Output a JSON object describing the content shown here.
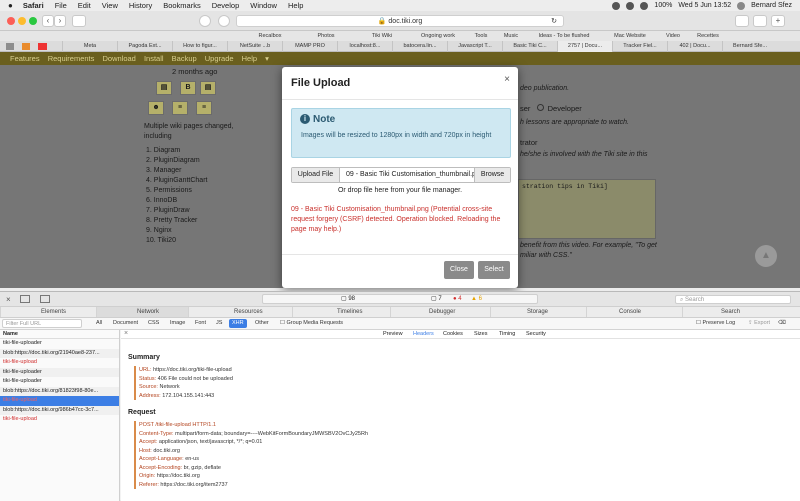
{
  "menubar": {
    "apple": "",
    "app": "Safari",
    "items": [
      "File",
      "Edit",
      "View",
      "History",
      "Bookmarks",
      "Develop",
      "Window",
      "Help"
    ],
    "battery": "100%",
    "clock": "Wed 5 Jun  13:52",
    "user": "Bernard Sfez"
  },
  "toolbar": {
    "url": "doc.tiki.org",
    "back": "‹",
    "forward": "›",
    "reload": "↻"
  },
  "favorites": [
    "Recalbox",
    "Photos",
    "Tiki Wiki",
    "Ongoing work",
    "Tools",
    "Music",
    "Ideas - To be flushed",
    "Mac Website",
    "Video",
    "Recettes"
  ],
  "tabs": [
    "Meta",
    "Pagoda Ext...",
    "How to figur...",
    "NetSuite ...b",
    "MAMP PRO",
    "localhost:8...",
    "batocera.lin...",
    "Javascript T...",
    "Basic Tiki C...",
    "2757 | Docu...",
    "Tracker Fiel...",
    "402 | Docu...",
    "Bernard Sfe..."
  ],
  "site": {
    "nav": [
      "Features",
      "Requirements",
      "Download",
      "Install",
      "Backup",
      "Upgrade",
      "Help"
    ],
    "nav_caret": "▾",
    "time_ago": "2 months ago",
    "summary_line1": "Multiple wiki pages changed,",
    "summary_line2": "including",
    "pages": [
      "1.  Diagram",
      "2.  PluginDiagram",
      "3.  Manager",
      "4.  PluginGanttChart",
      "5.  Permissions",
      "6.  InnoDB",
      "7.  PluginDraw",
      "8.  Pretty Tracker",
      "9.  Nginx",
      "10. Tiki20"
    ],
    "right_text1": "deo publication.",
    "right_radio1": "ser",
    "right_radio2": "Developer",
    "right_text2": "h lessons are appropriate to watch.",
    "right_text3": "trator",
    "right_text4": "he/she is involved with the Tiki site in this",
    "right_text5": "stration tips in Tiki]",
    "right_text6": "benefit from this video. For example, \"To get",
    "right_text7": "miliar with CSS.\""
  },
  "modal": {
    "title": "File Upload",
    "close": "×",
    "note_title": "Note",
    "note_icon": "i",
    "note_text": "Images will be resized to 1280px in width and 720px in height",
    "upload_label": "Upload File",
    "file_name": "09 - Basic Tiki Customisation_thumbnail.png",
    "browse": "Browse",
    "drop_text": "Or drop file here from your file manager.",
    "error": "09 - Basic Tiki Customisation_thumbnail.png (Potential cross-site request forgery (CSRF) detected. Operation blocked. Reloading the page may help.)",
    "close_button": "Close",
    "select_button": "Select"
  },
  "devtools": {
    "counts": {
      "resources": "98",
      "logs": "7",
      "errors": "4",
      "warnings": "6"
    },
    "tabs": [
      "Elements",
      "Network",
      "Resources",
      "Timelines",
      "Debugger",
      "Storage",
      "Console",
      "Search"
    ],
    "search_placeholder": "Search",
    "filter_placeholder": "Filter Full URL",
    "filter_types": [
      "All",
      "Document",
      "CSS",
      "Image",
      "Font",
      "JS",
      "XHR",
      "Other"
    ],
    "group_media": "Group Media Requests",
    "preserve_log": "Preserve Log",
    "export": "Export",
    "list_header": "Name",
    "requests": [
      {
        "name": "tiki-file-uploader",
        "status": "normal"
      },
      {
        "name": "blob:https://doc.tiki.org/21940ae8-237...",
        "status": "normal"
      },
      {
        "name": "tiki-file-upload",
        "status": "error"
      },
      {
        "name": "tiki-file-uploader",
        "status": "normal"
      },
      {
        "name": "tiki-file-uploader",
        "status": "normal"
      },
      {
        "name": "blob:https://doc.tiki.org/81823f98-80e...",
        "status": "normal"
      },
      {
        "name": "tiki-file-upload",
        "status": "selected"
      },
      {
        "name": "blob:https://doc.tiki.org/986b47cc-3c7...",
        "status": "normal"
      },
      {
        "name": "tiki-file-upload",
        "status": "error"
      }
    ],
    "detail_tabs": [
      "Preview",
      "Headers",
      "Cookies",
      "Sizes",
      "Timing",
      "Security"
    ],
    "summary_title": "Summary",
    "summary": [
      {
        "k": "URL:",
        "v": "https://doc.tiki.org/tiki-file-upload"
      },
      {
        "k": "Status:",
        "v": "406 File could not be uploaded"
      },
      {
        "k": "Source:",
        "v": "Network"
      },
      {
        "k": "Address:",
        "v": "172.104.155.141:443"
      }
    ],
    "request_title": "Request",
    "request_line": "POST /tiki-file-upload HTTP/1.1",
    "request": [
      {
        "k": "Content-Type:",
        "v": "multipart/form-data; boundary=----WebKitFormBoundaryJMWSBV2OvCJy25Rh"
      },
      {
        "k": "Accept:",
        "v": "application/json, text/javascript, */*; q=0.01"
      },
      {
        "k": "Host:",
        "v": "doc.tiki.org"
      },
      {
        "k": "Accept-Language:",
        "v": "en-us"
      },
      {
        "k": "Accept-Encoding:",
        "v": "br, gzip, deflate"
      },
      {
        "k": "Origin:",
        "v": "https://doc.tiki.org"
      },
      {
        "k": "Referer:",
        "v": "https://doc.tiki.org/item2737"
      }
    ]
  }
}
